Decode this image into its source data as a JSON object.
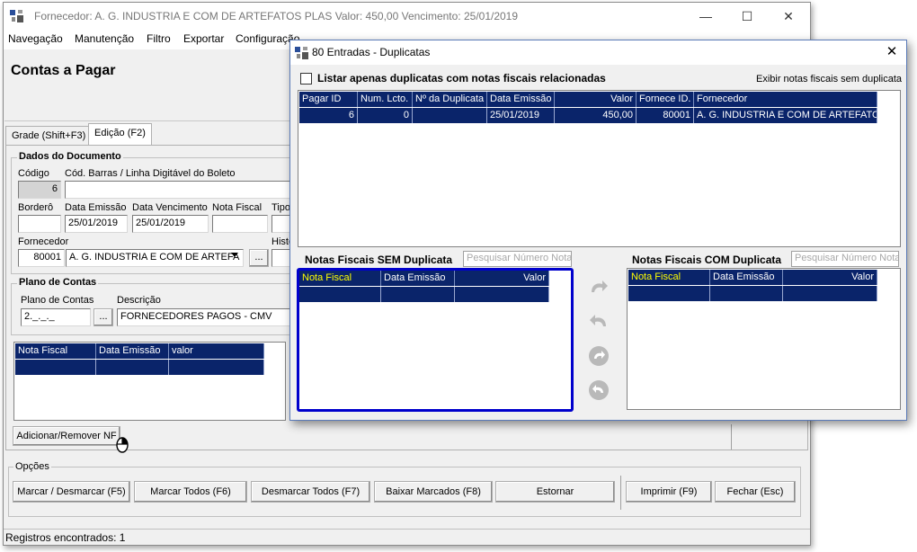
{
  "main_window": {
    "title": "Fornecedor: A. G. INDUSTRIA  E COM DE ARTEFATOS PLAS  Valor: 450,00  Vencimento: 25/01/2019",
    "controls": {
      "minimize": "—",
      "maximize": "☐",
      "close": "✕"
    },
    "menu": [
      "Navegação",
      "Manutenção",
      "Filtro",
      "Exportar",
      "Configuração"
    ],
    "page_title": "Contas a Pagar",
    "tabs": [
      "Grade (Shift+F3)",
      "Edição (F2)"
    ],
    "dados_documento": {
      "title": "Dados do Documento",
      "codigo_label": "Código",
      "codigo_value": "6",
      "barcode_label": "Cód. Barras / Linha Digitável do Boleto",
      "bordero_label": "Borderô",
      "data_emissao_label": "Data Emissão",
      "data_emissao_value": "25/01/2019",
      "data_vencimento_label": "Data Vencimento",
      "data_vencimento_value": "25/01/2019",
      "nota_fiscal_label": "Nota Fiscal",
      "tipo_label": "Tipo",
      "fornecedor_label": "Fornecedor",
      "fornecedor_code": "80001",
      "fornecedor_name": "A. G. INDUSTRIA  E COM DE ARTEFA",
      "historico_label": "Histó",
      "ellipsis": "..."
    },
    "plano_contas": {
      "title": "Plano de Contas",
      "plano_label": "Plano de Contas",
      "plano_value": "2._._._",
      "descricao_label": "Descrição",
      "descricao_value": "FORNECEDORES PAGOS - CMV",
      "ellipsis": "..."
    },
    "nf_grid": {
      "headers": [
        "Nota Fiscal",
        "Data Emissão",
        "valor"
      ]
    },
    "add_remove_button": "Adicionar/Remover NF",
    "options": {
      "title": "Opções",
      "buttons": [
        "Marcar / Desmarcar (F5)",
        "Marcar Todos (F6)",
        "Desmarcar Todos (F7)",
        "Baixar Marcados (F8)",
        "Estornar",
        "Imprimir (F9)",
        "Fechar (Esc)"
      ]
    },
    "status": "Registros encontrados: 1"
  },
  "dialog": {
    "title": "80 Entradas - Duplicatas",
    "close": "✕",
    "checkbox_label": "Listar apenas duplicatas com notas fiscais relacionadas",
    "show_without_link": "Exibir notas fiscais sem duplicata",
    "dup_grid": {
      "headers": [
        "Pagar ID",
        "Num. Lcto.",
        "Nº da Duplicata",
        "Data Emissão",
        "Valor",
        "Fornece ID.",
        "Fornecedor"
      ],
      "rows": [
        {
          "pagar_id": "6",
          "num_lcto": "0",
          "num_duplicata": "",
          "data_emissao": "25/01/2019",
          "valor": "450,00",
          "fornece_id": "80001",
          "fornecedor": "A. G. INDUSTRIA  E COM DE ARTEFATOS"
        }
      ]
    },
    "sem_duplicata": {
      "title": "Notas Fiscais SEM Duplicata",
      "search_placeholder": "Pesquisar Número Nota",
      "headers": [
        "Nota Fiscal",
        "Data Emissão",
        "Valor"
      ]
    },
    "com_duplicata": {
      "title": "Notas Fiscais COM Duplicata",
      "search_placeholder": "Pesquisar Número Nota",
      "headers": [
        "Nota Fiscal",
        "Data Emissão",
        "Valor"
      ]
    },
    "arrow_icons": [
      "redo-icon",
      "undo-icon",
      "redo-all-icon",
      "undo-all-icon"
    ]
  },
  "colors": {
    "grid_header": "#0a246a",
    "grid_highlight_text": "#ffff00",
    "focus_border": "#0000cc",
    "arrow_gray": "#b9b9b9"
  }
}
